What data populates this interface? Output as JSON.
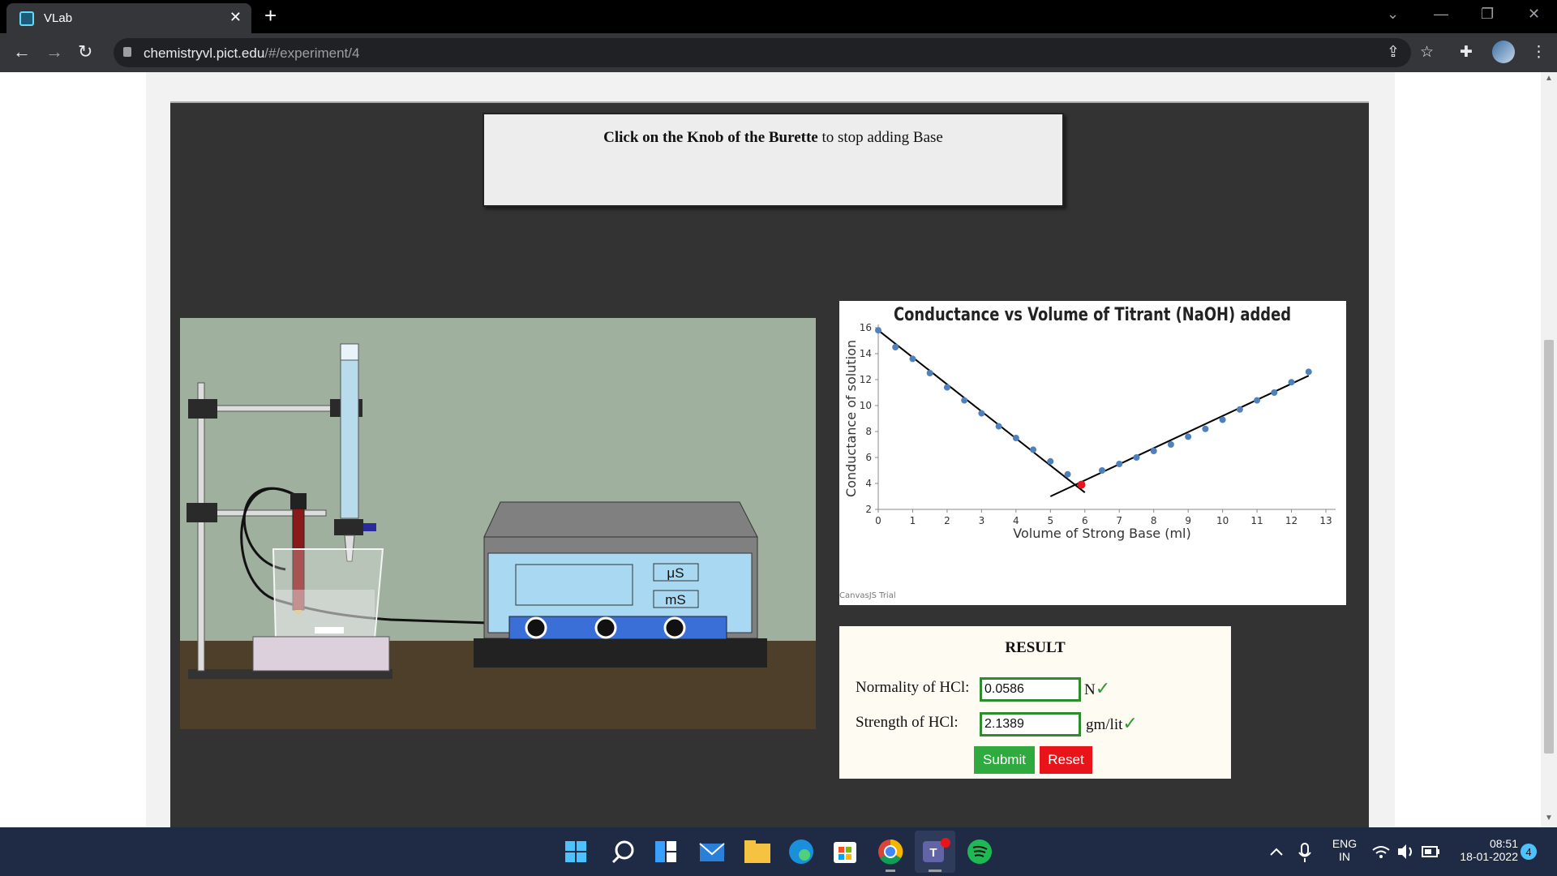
{
  "browser": {
    "tab_title": "VLab",
    "url_host": "chemistryvl.pict.edu",
    "url_path": "/#/experiment/4"
  },
  "instruction": {
    "bold": "Click on the Knob of the Burette",
    "rest": " to stop adding Base"
  },
  "meter": {
    "unit_us": "μS",
    "unit_ms": "mS"
  },
  "chart_data": {
    "type": "scatter",
    "title": "Conductance vs Volume of Titrant (NaOH) added",
    "xlabel": "Volume of Strong Base (ml)",
    "ylabel": "Conductance of solution",
    "xlim": [
      0,
      13
    ],
    "ylim": [
      2,
      16
    ],
    "x_ticks": [
      0,
      1,
      2,
      3,
      4,
      5,
      6,
      7,
      8,
      9,
      10,
      11,
      12,
      13
    ],
    "y_ticks": [
      2,
      4,
      6,
      8,
      10,
      12,
      14,
      16
    ],
    "watermark": "CanvasJS Trial",
    "series": [
      {
        "points": [
          [
            0,
            15.8
          ],
          [
            0.5,
            14.5
          ],
          [
            1,
            13.6
          ],
          [
            1.5,
            12.5
          ],
          [
            2,
            11.4
          ],
          [
            2.5,
            10.4
          ],
          [
            3,
            9.4
          ],
          [
            3.5,
            8.4
          ],
          [
            4,
            7.5
          ],
          [
            4.5,
            6.6
          ],
          [
            5,
            5.7
          ],
          [
            5.5,
            4.7
          ],
          [
            6.5,
            5.0
          ],
          [
            7,
            5.5
          ],
          [
            7.5,
            6.0
          ],
          [
            8,
            6.5
          ],
          [
            8.5,
            7.0
          ],
          [
            9,
            7.6
          ],
          [
            9.5,
            8.2
          ],
          [
            10,
            8.9
          ],
          [
            10.5,
            9.7
          ],
          [
            11,
            10.4
          ],
          [
            11.5,
            11.0
          ],
          [
            12,
            11.8
          ],
          [
            12.5,
            12.6
          ]
        ],
        "color": "#4f81bc"
      }
    ],
    "fit_lines": [
      [
        [
          0,
          15.8
        ],
        [
          6.0,
          3.3
        ]
      ],
      [
        [
          5.0,
          3.0
        ],
        [
          12.5,
          12.3
        ]
      ]
    ],
    "equivalence_point": [
      5.9,
      3.9
    ],
    "equivalence_color": "#e8141a"
  },
  "result": {
    "heading": "RESULT",
    "normality_label": "Normality of HCl:",
    "normality_value": "0.0586",
    "normality_unit": "N",
    "strength_label": "Strength of HCl:",
    "strength_value": "2.1389",
    "strength_unit": "gm/lit",
    "check": "✓",
    "submit_label": "Submit",
    "reset_label": "Reset"
  },
  "taskbar": {
    "lang_top": "ENG",
    "lang_bottom": "IN",
    "time": "08:51",
    "date": "18-01-2022",
    "notifications": "4"
  }
}
